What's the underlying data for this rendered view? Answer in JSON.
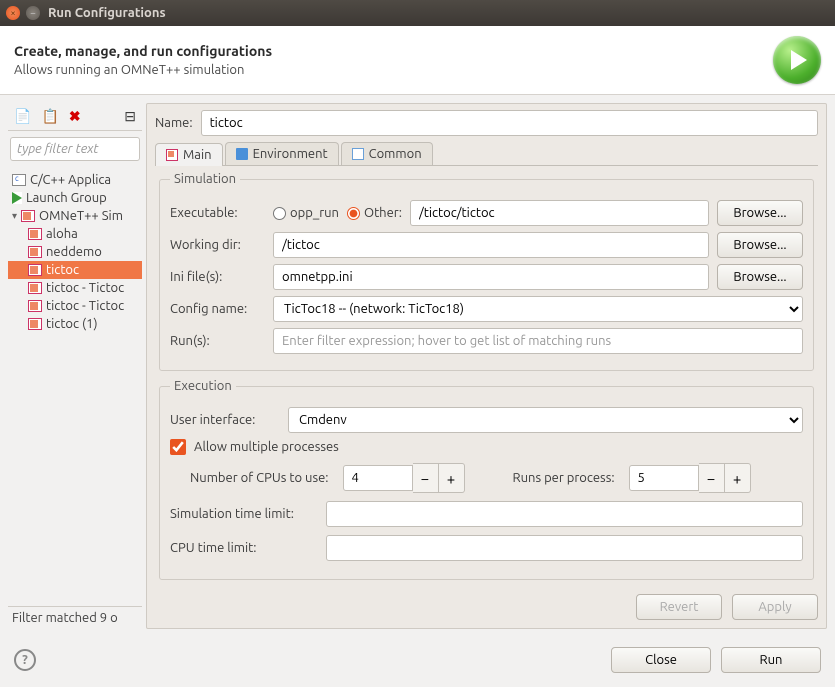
{
  "window": {
    "title": "Run Configurations"
  },
  "header": {
    "title": "Create, manage, and run configurations",
    "subtitle": "Allows running an OMNeT++ simulation"
  },
  "left": {
    "filter_placeholder": "type filter text",
    "items": [
      {
        "label": "C/C++ Applica"
      },
      {
        "label": "Launch Group"
      },
      {
        "label": "OMNeT++ Sim"
      }
    ],
    "children": [
      {
        "label": "aloha"
      },
      {
        "label": "neddemo"
      },
      {
        "label": "tictoc"
      },
      {
        "label": "tictoc - Tictoc"
      },
      {
        "label": "tictoc - Tictoc"
      },
      {
        "label": "tictoc (1)"
      }
    ],
    "status": "Filter matched 9 o"
  },
  "form": {
    "name_label": "Name:",
    "name_value": "tictoc",
    "tabs": {
      "main": "Main",
      "env": "Environment",
      "common": "Common"
    },
    "sim": {
      "legend": "Simulation",
      "exe_label": "Executable:",
      "opp_run": "opp_run",
      "other": "Other:",
      "other_value": "/tictoc/tictoc",
      "browse": "Browse...",
      "wd_label": "Working dir:",
      "wd_value": "/tictoc",
      "ini_label": "Ini file(s):",
      "ini_value": "omnetpp.ini",
      "cfg_label": "Config name:",
      "cfg_value": "TicToc18 -- (network: TicToc18)",
      "runs_label": "Run(s):",
      "runs_placeholder": "Enter filter expression; hover to get list of matching runs"
    },
    "exec": {
      "legend": "Execution",
      "ui_label": "User interface:",
      "ui_value": "Cmdenv",
      "allow": "Allow multiple processes",
      "cpus_label": "Number of CPUs to use:",
      "cpus_value": "4",
      "rpp_label": "Runs per process:",
      "rpp_value": "5",
      "simlim_label": "Simulation time limit:",
      "cpulim_label": "CPU time limit:"
    },
    "revert": "Revert",
    "apply": "Apply"
  },
  "footer": {
    "close": "Close",
    "run": "Run"
  }
}
